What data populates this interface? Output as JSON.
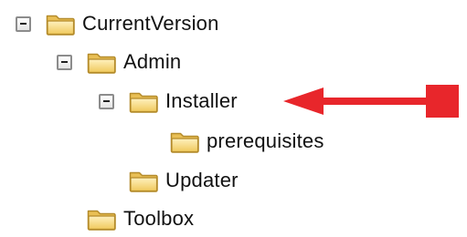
{
  "tree": {
    "nodes": [
      {
        "label": "CurrentVersion",
        "expanded": true,
        "icon": "folder-icon"
      },
      {
        "label": "Admin",
        "expanded": true,
        "icon": "folder-icon"
      },
      {
        "label": "Installer",
        "expanded": true,
        "icon": "folder-icon"
      },
      {
        "label": "prerequisites",
        "expanded": null,
        "icon": "folder-icon"
      },
      {
        "label": "Updater",
        "expanded": null,
        "icon": "folder-icon"
      },
      {
        "label": "Toolbox",
        "expanded": null,
        "icon": "folder-icon"
      }
    ]
  },
  "annotation": {
    "color": "#e8262b",
    "target": "Installer",
    "icon": "red-arrow-icon"
  },
  "colors": {
    "folder_fill": "#f5d77a",
    "folder_edge": "#b8912e",
    "toggle_border": "#8c8c8c"
  }
}
